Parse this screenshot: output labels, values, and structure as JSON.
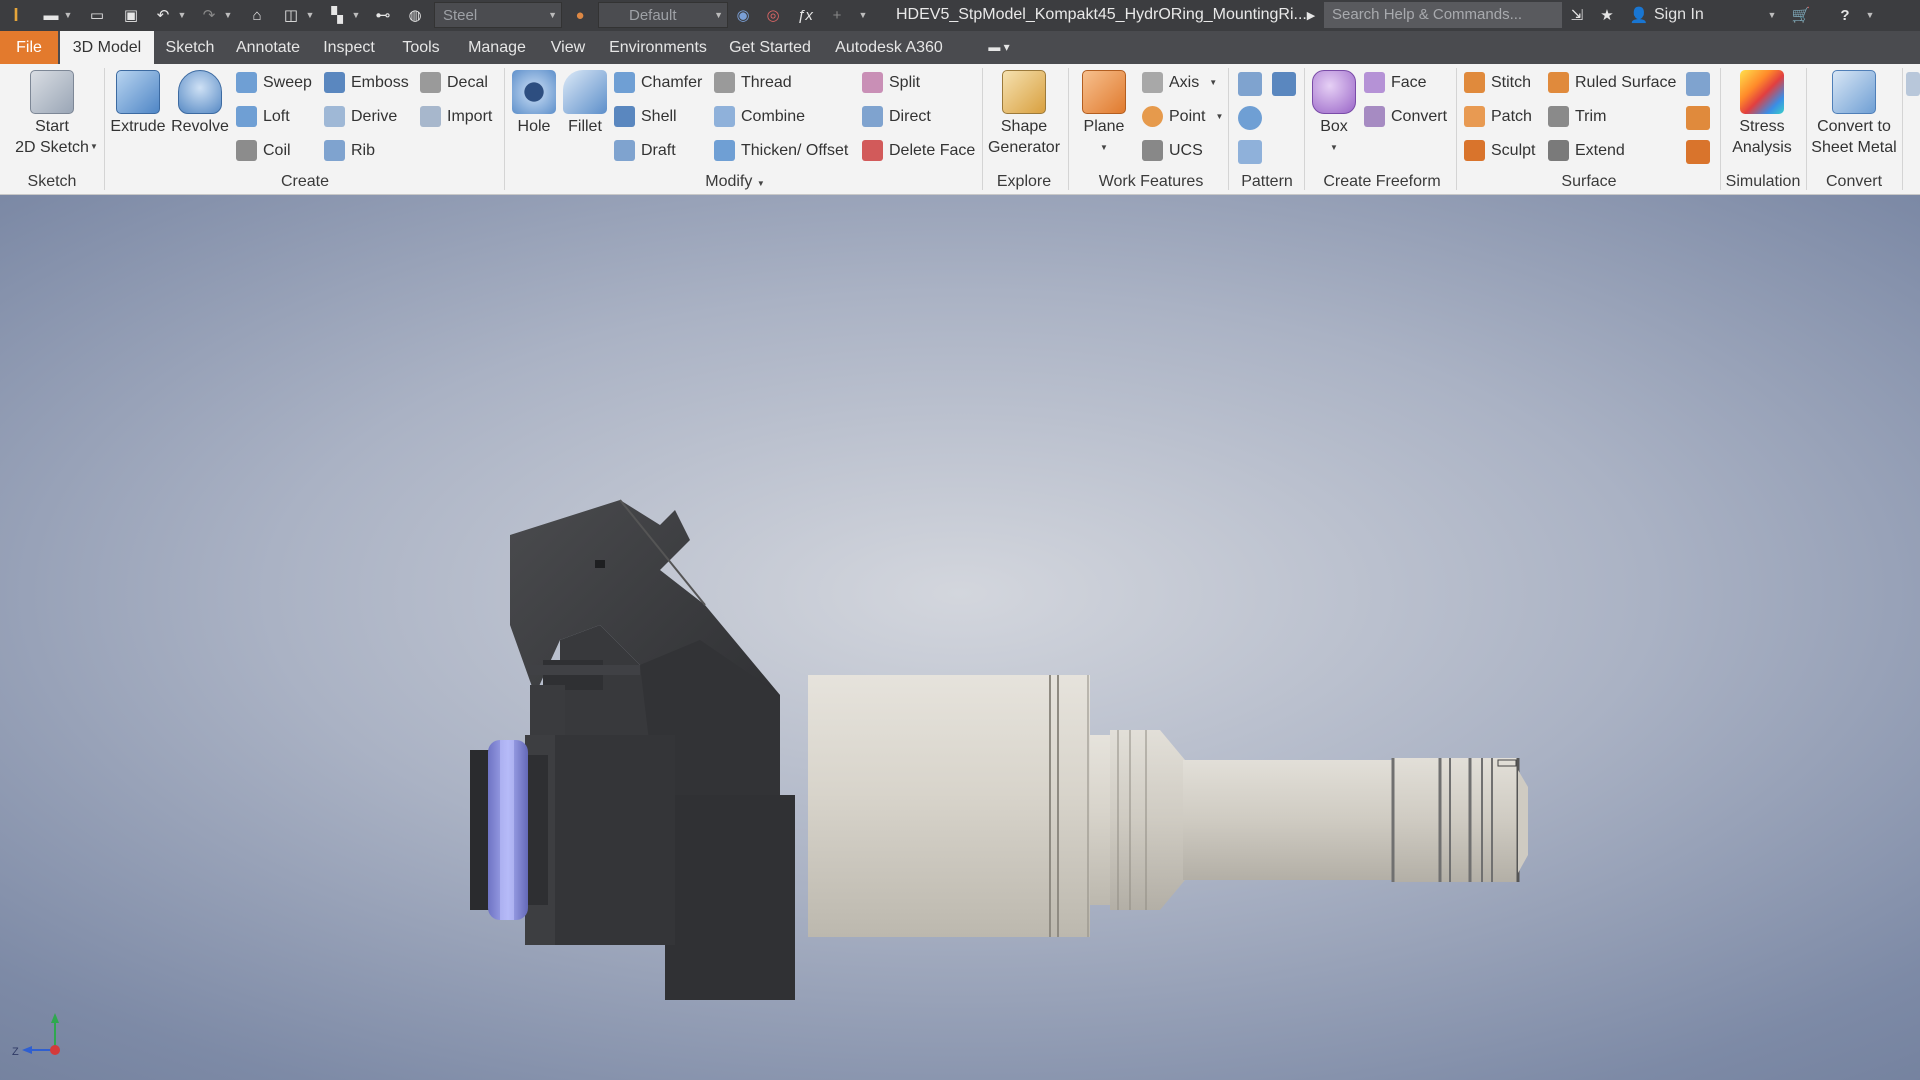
{
  "titlebar": {
    "material_select": "Steel",
    "appearance_select": "Default",
    "document_title": "HDEV5_StpModel_Kompakt45_HydrORing_MountingRi...",
    "search_placeholder": "Search Help & Commands...",
    "sign_in": "Sign In"
  },
  "tabs": [
    "File",
    "3D Model",
    "Sketch",
    "Annotate",
    "Inspect",
    "Tools",
    "Manage",
    "View",
    "Environments",
    "Get Started",
    "Autodesk A360"
  ],
  "ribbon": {
    "sketch": {
      "label": "Sketch",
      "start_sketch": "Start\n2D Sketch"
    },
    "create": {
      "label": "Create",
      "extrude": "Extrude",
      "revolve": "Revolve",
      "sweep": "Sweep",
      "loft": "Loft",
      "coil": "Coil",
      "emboss": "Emboss",
      "derive": "Derive",
      "rib": "Rib",
      "decal": "Decal",
      "import": "Import"
    },
    "modify": {
      "label": "Modify",
      "hole": "Hole",
      "fillet": "Fillet",
      "chamfer": "Chamfer",
      "shell": "Shell",
      "draft": "Draft",
      "thread": "Thread",
      "combine": "Combine",
      "thicken": "Thicken/ Offset",
      "split": "Split",
      "direct": "Direct",
      "delete_face": "Delete Face"
    },
    "explore": {
      "label": "Explore",
      "shape_generator": "Shape\nGenerator"
    },
    "work_features": {
      "label": "Work Features",
      "plane": "Plane",
      "axis": "Axis",
      "point": "Point",
      "ucs": "UCS"
    },
    "pattern": {
      "label": "Pattern"
    },
    "create_freeform": {
      "label": "Create Freeform",
      "box": "Box",
      "face": "Face",
      "convert": "Convert"
    },
    "surface": {
      "label": "Surface",
      "stitch": "Stitch",
      "patch": "Patch",
      "sculpt": "Sculpt",
      "ruled_surface": "Ruled Surface",
      "trim": "Trim",
      "extend": "Extend"
    },
    "simulation": {
      "label": "Simulation",
      "stress_analysis": "Stress\nAnalysis"
    },
    "convert": {
      "label": "Convert",
      "sheet_metal": "Convert to\nSheet Metal"
    }
  },
  "viewport": {
    "triad_z_label": "Z"
  },
  "colors": {
    "file_tab": "#e37a2d",
    "titlebar": "#3c3d40",
    "ribbon": "#f3f3f3"
  }
}
